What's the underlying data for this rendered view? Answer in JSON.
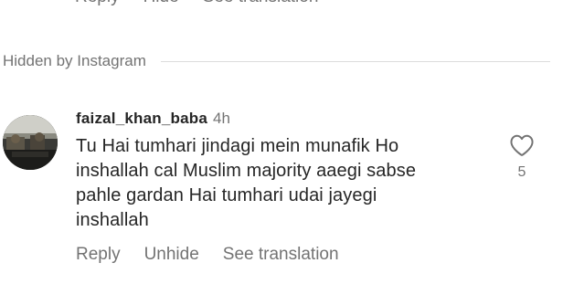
{
  "previous_comment": {
    "actions": [
      "Reply",
      "Hide",
      "See translation"
    ]
  },
  "divider": {
    "label": "Hidden by Instagram"
  },
  "comment": {
    "username": "faizal_khan_baba",
    "time": "4h",
    "text_lines": [
      "Tu Hai tumhari jindagi mein munafik Ho",
      "inshallah cal Muslim majority aaegi sabse",
      "pahle gardan Hai tumhari udai jayegi",
      "inshallah"
    ],
    "actions": {
      "reply": "Reply",
      "unhide": "Unhide",
      "see_translation": "See translation"
    },
    "like_icon": "heart-outline-icon",
    "like_count": "5"
  },
  "colors": {
    "text_primary": "#262626",
    "text_secondary": "#737373",
    "divider": "#dbdbdb"
  }
}
